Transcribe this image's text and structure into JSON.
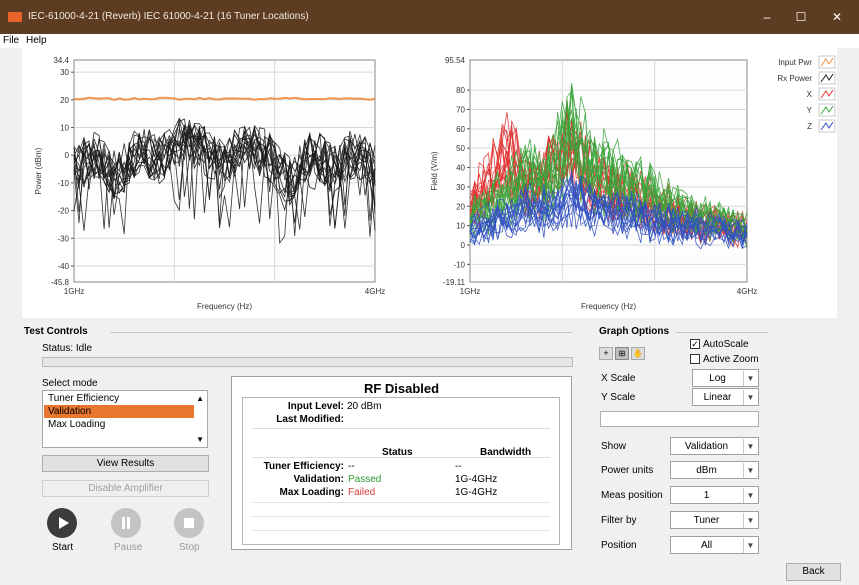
{
  "window": {
    "title": "IEC-61000-4-21 (Reverb)  IEC 61000-4-21 (16 Tuner Locations)",
    "minimize": "–",
    "maximize": "☐",
    "close": "✕"
  },
  "menu": [
    "File",
    "Help"
  ],
  "chart_data": [
    {
      "type": "line",
      "title": "",
      "xlabel": "Frequency (Hz)",
      "ylabel": "Power (dBm)",
      "ylim": [
        -45.8,
        34.4
      ],
      "y_min_label": "-45.8",
      "y_max_label": "34.4",
      "y_ticks": [
        "30",
        "20",
        "10",
        "0",
        "-10",
        "-20",
        "-30",
        "-40"
      ],
      "x_ticks": [
        "1GHz",
        "4GHz"
      ],
      "grid": true,
      "series": [
        {
          "name": "Input Pwr",
          "color": "#f08a3c",
          "values": [
            20.3,
            20.5,
            20.2,
            20.4,
            20.6,
            20.3,
            20.5,
            20.4,
            20.2,
            20.5,
            20.6,
            20.3,
            20.4,
            20.5,
            20.3
          ]
        },
        {
          "name": "Rx Power",
          "color": "#1a1a1a",
          "note_traces": 16,
          "values": [
            -5,
            0,
            -8,
            3,
            -2,
            5,
            2,
            -3,
            4,
            0,
            -10,
            2,
            -5,
            1,
            -4
          ]
        }
      ]
    },
    {
      "type": "line",
      "title": "",
      "xlabel": "Frequency (Hz)",
      "ylabel": "Field (V/m)",
      "ylim": [
        -19.11,
        95.54
      ],
      "y_min_label": "-19.11",
      "y_max_label": "95.54",
      "y_ticks": [
        "80",
        "70",
        "60",
        "50",
        "40",
        "30",
        "20",
        "10",
        "0",
        "-10"
      ],
      "x_ticks": [
        "1GHz",
        "4GHz"
      ],
      "grid": true,
      "series": [
        {
          "name": "X",
          "color": "#e03030",
          "values": [
            20,
            35,
            48,
            30,
            40,
            55,
            38,
            30,
            28,
            22,
            18,
            15,
            12,
            10,
            8
          ]
        },
        {
          "name": "Y",
          "color": "#3aa43a",
          "values": [
            15,
            22,
            30,
            40,
            35,
            60,
            45,
            38,
            32,
            28,
            22,
            18,
            14,
            11,
            9
          ]
        },
        {
          "name": "Z",
          "color": "#3050c0",
          "values": [
            8,
            12,
            15,
            20,
            18,
            25,
            22,
            18,
            16,
            14,
            12,
            10,
            8,
            7,
            6
          ]
        }
      ]
    }
  ],
  "legend": [
    {
      "name": "Input Pwr",
      "color": "#f08a3c"
    },
    {
      "name": "Rx Power",
      "color": "#1a1a1a"
    },
    {
      "name": "X",
      "color": "#e03030"
    },
    {
      "name": "Y",
      "color": "#3aa43a"
    },
    {
      "name": "Z",
      "color": "#3050c0"
    }
  ],
  "test_controls": {
    "title": "Test Controls",
    "status": "Status: Idle",
    "progress": 0,
    "select_mode_label": "Select mode",
    "modes": [
      "Tuner Efficiency",
      "Validation",
      "Max Loading"
    ],
    "selected_mode": "Validation",
    "view_results": "View Results",
    "disable_amplifier": "Disable Amplifier",
    "start": "Start",
    "pause": "Pause",
    "stop": "Stop"
  },
  "status_panel": {
    "heading": "RF Disabled",
    "input_level_label": "Input Level:",
    "input_level_value": "20 dBm",
    "last_modified_label": "Last Modified:",
    "last_modified_value": "",
    "col_status": "Status",
    "col_bandwidth": "Bandwidth",
    "rows": [
      {
        "label": "Tuner Efficiency:",
        "status": "--",
        "bandwidth": "--",
        "status_color": "#000000"
      },
      {
        "label": "Validation:",
        "status": "Passed",
        "bandwidth": "1G-4GHz",
        "status_color": "#2e9a2e"
      },
      {
        "label": "Max Loading:",
        "status": "Failed",
        "bandwidth": "1G-4GHz",
        "status_color": "#d93a3a"
      }
    ]
  },
  "graph_options": {
    "title": "Graph Options",
    "autoscale_label": "AutoScale",
    "autoscale_checked": true,
    "active_zoom_label": "Active Zoom",
    "active_zoom_checked": false,
    "x_scale_label": "X Scale",
    "x_scale_value": "Log",
    "y_scale_label": "Y Scale",
    "y_scale_value": "Linear",
    "show_label": "Show",
    "show_value": "Validation",
    "power_units_label": "Power units",
    "power_units_value": "dBm",
    "meas_position_label": "Meas position",
    "meas_position_value": "1",
    "filter_by_label": "Filter by",
    "filter_by_value": "Tuner",
    "position_label": "Position",
    "position_value": "All"
  },
  "back_button": "Back"
}
